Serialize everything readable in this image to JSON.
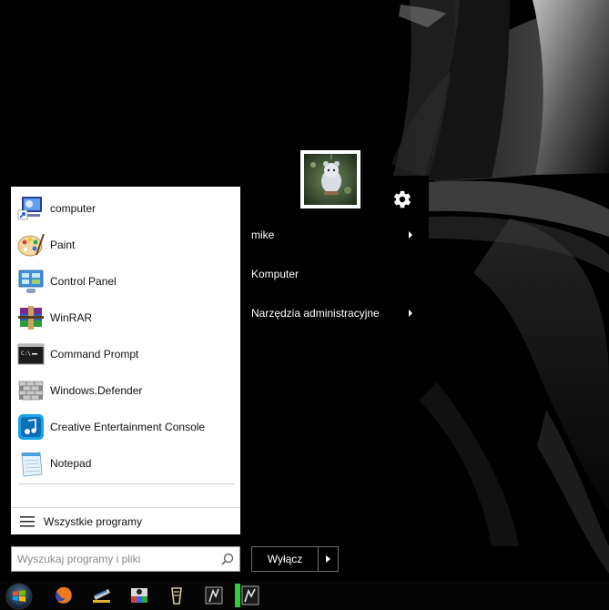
{
  "programs": [
    {
      "label": "computer",
      "icon": "computer-icon"
    },
    {
      "label": "Paint",
      "icon": "paint-icon"
    },
    {
      "label": "Control Panel",
      "icon": "control-panel-icon"
    },
    {
      "label": "WinRAR",
      "icon": "winrar-icon"
    },
    {
      "label": "Command Prompt",
      "icon": "command-prompt-icon"
    },
    {
      "label": "Windows.Defender",
      "icon": "defender-icon"
    },
    {
      "label": "Creative Entertainment Console",
      "icon": "creative-console-icon"
    },
    {
      "label": "Notepad",
      "icon": "notepad-icon"
    }
  ],
  "all_programs": {
    "label": "Wszystkie programy",
    "icon": "hamburger-icon"
  },
  "right_pane": {
    "items": [
      {
        "label": "mike",
        "has_submenu": true
      },
      {
        "label": "Komputer",
        "has_submenu": false
      },
      {
        "label": "Narzędzia administracyjne",
        "has_submenu": true
      }
    ],
    "settings_icon": "gear-icon",
    "user_picture_icon": "user-avatar-icon"
  },
  "search": {
    "placeholder": "Wyszukaj programy i pliki",
    "value": ""
  },
  "shutdown": {
    "label": "Wyłącz"
  },
  "taskbar": {
    "icons": [
      "start-orb-icon",
      "firefox-icon",
      "app-icon",
      "media-app-icon",
      "tool-icon",
      "game-icon",
      "active-app-icon"
    ]
  }
}
